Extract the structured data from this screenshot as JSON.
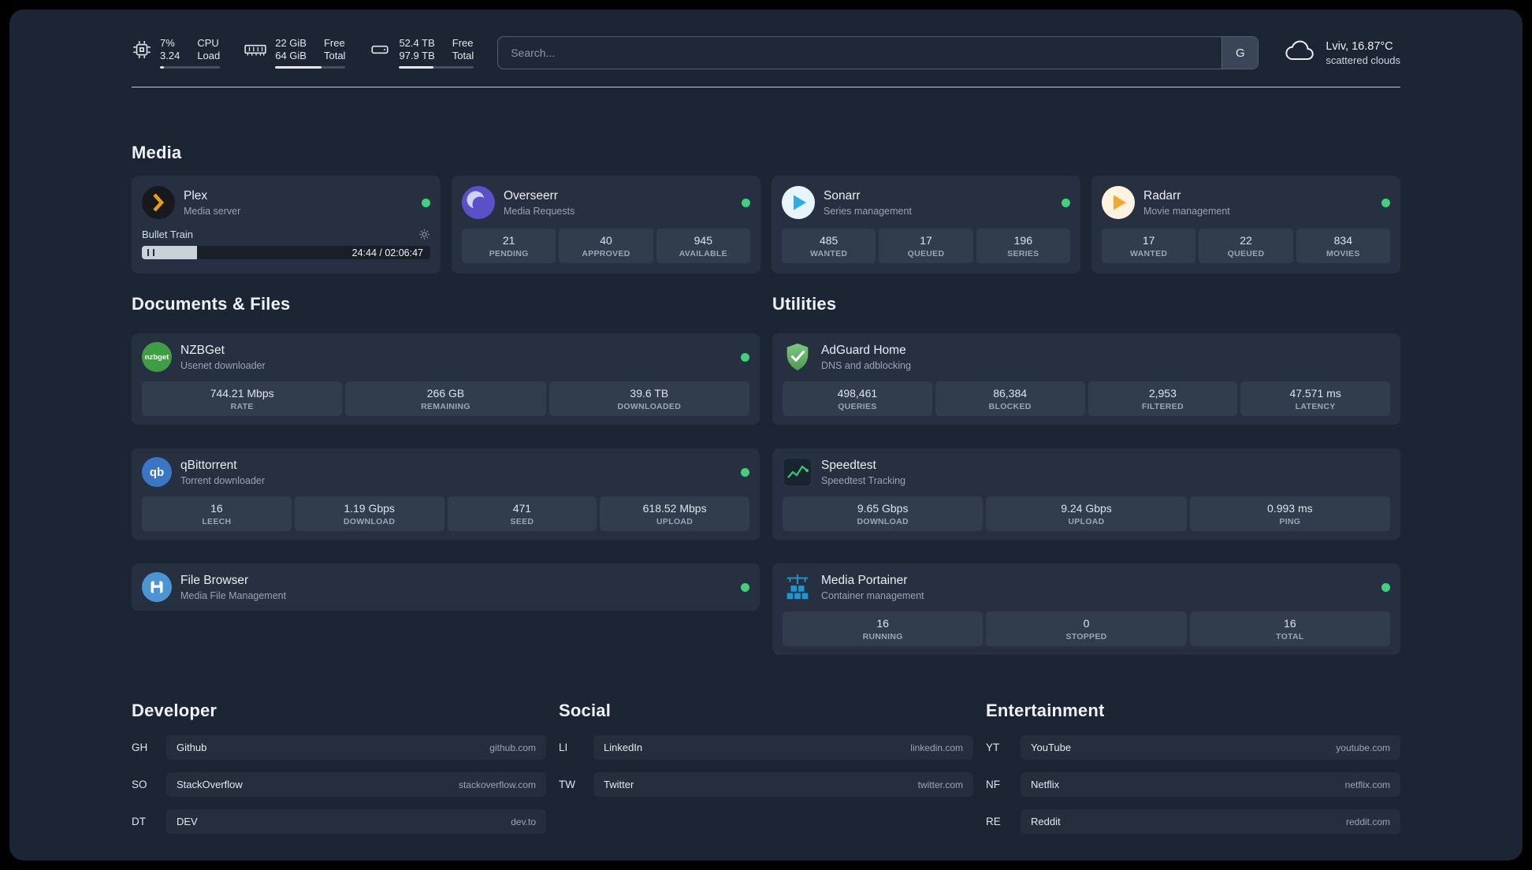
{
  "topbar": {
    "cpu": {
      "value": "7%",
      "sub": "3.24",
      "label": "CPU",
      "sublabel": "Load",
      "bar_percent": 7
    },
    "memory": {
      "value": "22 GiB",
      "sub": "64 GiB",
      "label": "Free",
      "sublabel": "Total",
      "bar_percent": 66
    },
    "disk": {
      "value": "52.4 TB",
      "sub": "97.9 TB",
      "label": "Free",
      "sublabel": "Total",
      "bar_percent": 46
    },
    "search": {
      "placeholder": "Search...",
      "provider_label": "G"
    },
    "weather": {
      "location": "Lviv, 16.87°C",
      "condition": "scattered clouds"
    }
  },
  "media": {
    "title": "Media",
    "plex": {
      "name": "Plex",
      "desc": "Media server",
      "icon": "plex-icon",
      "status": "online",
      "now_playing": {
        "title": "Bullet Train",
        "time": "24:44 / 02:06:47",
        "progress_percent": 19
      }
    },
    "overseerr": {
      "name": "Overseerr",
      "desc": "Media Requests",
      "icon": "overseerr-icon",
      "status": "online",
      "stats": [
        {
          "value": "21",
          "label": "PENDING"
        },
        {
          "value": "40",
          "label": "APPROVED"
        },
        {
          "value": "945",
          "label": "AVAILABLE"
        }
      ]
    },
    "sonarr": {
      "name": "Sonarr",
      "desc": "Series management",
      "icon": "sonarr-icon",
      "status": "online",
      "stats": [
        {
          "value": "485",
          "label": "WANTED"
        },
        {
          "value": "17",
          "label": "QUEUED"
        },
        {
          "value": "196",
          "label": "SERIES"
        }
      ]
    },
    "radarr": {
      "name": "Radarr",
      "desc": "Movie management",
      "icon": "radarr-icon",
      "status": "online",
      "stats": [
        {
          "value": "17",
          "label": "WANTED"
        },
        {
          "value": "22",
          "label": "QUEUED"
        },
        {
          "value": "834",
          "label": "MOVIES"
        }
      ]
    }
  },
  "documents": {
    "title": "Documents & Files",
    "nzbget": {
      "name": "NZBGet",
      "desc": "Usenet downloader",
      "icon": "nzbget-icon",
      "status": "online",
      "stats": [
        {
          "value": "744.21 Mbps",
          "label": "RATE"
        },
        {
          "value": "266 GB",
          "label": "REMAINING"
        },
        {
          "value": "39.6 TB",
          "label": "DOWNLOADED"
        }
      ]
    },
    "qbittorrent": {
      "name": "qBittorrent",
      "desc": "Torrent downloader",
      "icon": "qbittorrent-icon",
      "status": "online",
      "stats": [
        {
          "value": "16",
          "label": "LEECH"
        },
        {
          "value": "1.19 Gbps",
          "label": "DOWNLOAD"
        },
        {
          "value": "471",
          "label": "SEED"
        },
        {
          "value": "618.52 Mbps",
          "label": "UPLOAD"
        }
      ]
    },
    "filebrowser": {
      "name": "File Browser",
      "desc": "Media File Management",
      "icon": "filebrowser-icon",
      "status": "online"
    }
  },
  "utilities": {
    "title": "Utilities",
    "adguard": {
      "name": "AdGuard Home",
      "desc": "DNS and adblocking",
      "icon": "adguard-icon",
      "stats": [
        {
          "value": "498,461",
          "label": "QUERIES"
        },
        {
          "value": "86,384",
          "label": "BLOCKED"
        },
        {
          "value": "2,953",
          "label": "FILTERED"
        },
        {
          "value": "47.571 ms",
          "label": "LATENCY"
        }
      ]
    },
    "speedtest": {
      "name": "Speedtest",
      "desc": "Speedtest Tracking",
      "icon": "speedtest-icon",
      "stats": [
        {
          "value": "9.65 Gbps",
          "label": "DOWNLOAD"
        },
        {
          "value": "9.24 Gbps",
          "label": "UPLOAD"
        },
        {
          "value": "0.993 ms",
          "label": "PING"
        }
      ]
    },
    "portainer": {
      "name": "Media Portainer",
      "desc": "Container management",
      "icon": "portainer-icon",
      "status": "online",
      "stats": [
        {
          "value": "16",
          "label": "RUNNING"
        },
        {
          "value": "0",
          "label": "STOPPED"
        },
        {
          "value": "16",
          "label": "TOTAL"
        }
      ]
    }
  },
  "bookmarks": {
    "developer": {
      "title": "Developer",
      "items": [
        {
          "abbr": "GH",
          "name": "Github",
          "domain": "github.com"
        },
        {
          "abbr": "SO",
          "name": "StackOverflow",
          "domain": "stackoverflow.com"
        },
        {
          "abbr": "DT",
          "name": "DEV",
          "domain": "dev.to"
        }
      ]
    },
    "social": {
      "title": "Social",
      "items": [
        {
          "abbr": "LI",
          "name": "LinkedIn",
          "domain": "linkedin.com"
        },
        {
          "abbr": "TW",
          "name": "Twitter",
          "domain": "twitter.com"
        }
      ]
    },
    "entertainment": {
      "title": "Entertainment",
      "items": [
        {
          "abbr": "YT",
          "name": "YouTube",
          "domain": "youtube.com"
        },
        {
          "abbr": "NF",
          "name": "Netflix",
          "domain": "netflix.com"
        },
        {
          "abbr": "RE",
          "name": "Reddit",
          "domain": "reddit.com"
        }
      ]
    }
  },
  "colors": {
    "status_online": "#41d07c",
    "plex_amber": "#e5a00d",
    "overseerr_purple": "#5a50c7",
    "sonarr_blue": "#2dabe3",
    "radarr_amber": "#f0a82c",
    "nzbget_green": "#3f9e43",
    "qbittorrent_blue": "#3a76c4",
    "filebrowser_blue": "#4b96d2",
    "adguard_green": "#67b369",
    "speedtest_green": "#2ecc71",
    "portainer_blue": "#1899d6"
  }
}
